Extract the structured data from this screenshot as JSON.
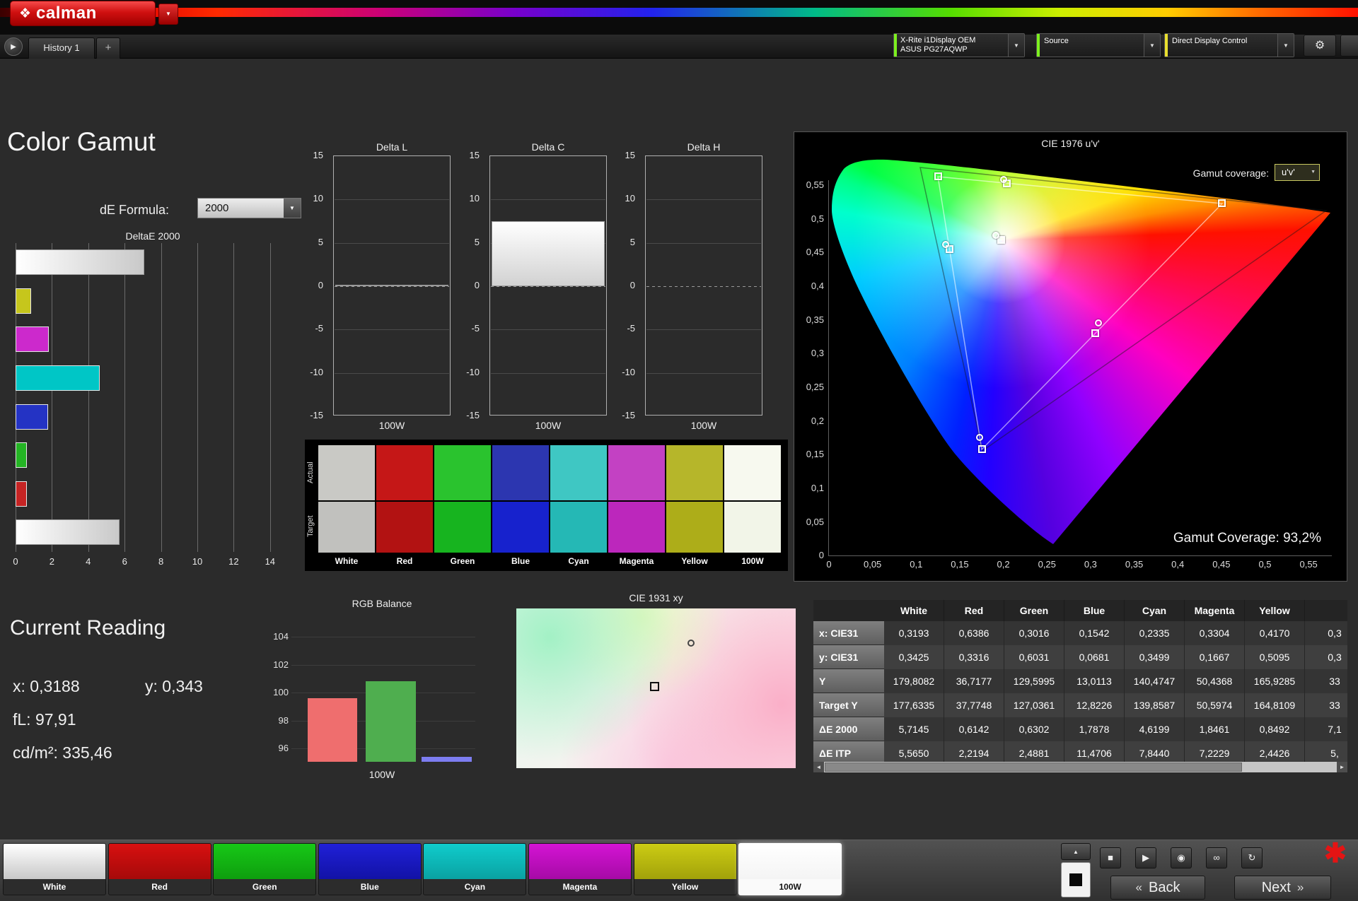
{
  "header": {
    "logo_text": "calman",
    "logo_icon": "❖",
    "logo_caret": "▼",
    "tab_scroll_icon": "▶",
    "history_tab": "History 1",
    "add_tab": "+",
    "meter_dropdown": {
      "line1": "X-Rite i1Display OEM",
      "line2": "ASUS PG27AQWP",
      "caret": "▼",
      "stripe": "#7df01e"
    },
    "source_dropdown": {
      "label": "Source",
      "caret": "▼",
      "stripe": "#7df01e"
    },
    "display_dropdown": {
      "label": "Direct Display Control",
      "caret": "▼",
      "stripe": "#e8df2e"
    },
    "settings_icon": "⚙"
  },
  "page": {
    "title": "Color Gamut",
    "de_formula_label": "dE Formula:",
    "de_formula_value": "2000",
    "de_formula_caret": "▼"
  },
  "chart_data": [
    {
      "type": "bar",
      "title": "DeltaE 2000",
      "orientation": "horizontal",
      "categories": [
        "100W",
        "Yellow",
        "Magenta",
        "Cyan",
        "Blue",
        "Green",
        "Red",
        "White"
      ],
      "values": [
        7.1,
        0.8492,
        1.8461,
        4.6199,
        1.7878,
        0.6302,
        0.6142,
        5.7145
      ],
      "colors": [
        "white-gradient",
        "#c6c61c",
        "#cc29cc",
        "#00c6c6",
        "#2433c4",
        "#24b424",
        "#c62424",
        "white-gradient"
      ],
      "x_ticks": [
        0,
        2,
        4,
        6,
        8,
        10,
        12,
        14
      ],
      "xlim": [
        0,
        15.1
      ]
    },
    {
      "type": "bar",
      "title": "Delta L",
      "xlabel": "100W",
      "values": [
        0.2
      ],
      "y_ticks": [
        15,
        10,
        5,
        0,
        -5,
        -10,
        -15
      ],
      "ylim": [
        -15,
        15
      ]
    },
    {
      "type": "bar",
      "title": "Delta C",
      "xlabel": "100W",
      "values": [
        7.5
      ],
      "y_ticks": [
        15,
        10,
        5,
        0,
        -5,
        -10,
        -15
      ],
      "ylim": [
        -15,
        15
      ]
    },
    {
      "type": "bar",
      "title": "Delta H",
      "xlabel": "100W",
      "values": [
        0
      ],
      "y_ticks": [
        15,
        10,
        5,
        0,
        -5,
        -10,
        -15
      ],
      "ylim": [
        -15,
        15
      ]
    },
    {
      "type": "bar",
      "title": "RGB Balance",
      "xlabel": "100W",
      "categories": [
        "Red",
        "Green",
        "Blue"
      ],
      "values": [
        99.6,
        100.8,
        95.4
      ],
      "colors": [
        "#ef6e6e",
        "#4fae4f",
        "#7d7df0"
      ],
      "y_ticks": [
        104,
        102,
        100,
        98,
        96
      ],
      "ylim": [
        95,
        105
      ]
    },
    {
      "type": "scatter",
      "title": "CIE 1976 u'v'",
      "coverage_label": "Gamut coverage:",
      "coverage_mode": "u'v'",
      "coverage_caret": "▼",
      "coverage_text": "Gamut Coverage:  93,2%",
      "x_ticks": [
        "0",
        "0,05",
        "0,1",
        "0,15",
        "0,2",
        "0,25",
        "0,3",
        "0,35",
        "0,4",
        "0,45",
        "0,5",
        "0,55"
      ],
      "y_ticks": [
        "0,55",
        "0,5",
        "0,45",
        "0,4",
        "0,35",
        "0,3",
        "0,25",
        "0,2",
        "0,15",
        "0,1",
        "0,05",
        "0"
      ],
      "targets": [
        {
          "name": "red",
          "u": 0.4507,
          "v": 0.5229
        },
        {
          "name": "green",
          "u": 0.125,
          "v": 0.5625
        },
        {
          "name": "blue",
          "u": 0.1754,
          "v": 0.1579
        },
        {
          "name": "cyan",
          "u": 0.1383,
          "v": 0.4554
        },
        {
          "name": "magenta",
          "u": 0.3051,
          "v": 0.3298
        },
        {
          "name": "yellow",
          "u": 0.2039,
          "v": 0.5529
        },
        {
          "name": "white",
          "u": 0.1978,
          "v": 0.4683
        }
      ],
      "measured": [
        {
          "name": "white",
          "u": 0.191,
          "v": 0.475
        },
        {
          "name": "cyan",
          "u": 0.134,
          "v": 0.462
        },
        {
          "name": "magenta",
          "u": 0.309,
          "v": 0.345
        },
        {
          "name": "yellow",
          "u": 0.2,
          "v": 0.558
        },
        {
          "name": "blue",
          "u": 0.173,
          "v": 0.175
        }
      ]
    },
    {
      "type": "scatter",
      "title": "CIE 1931 xy",
      "markers": [
        {
          "shape": "circle",
          "fx": 0.625,
          "fy": 0.215
        },
        {
          "shape": "square",
          "fx": 0.495,
          "fy": 0.49
        }
      ]
    },
    {
      "type": "table",
      "headers": [
        "White",
        "Red",
        "Green",
        "Blue",
        "Cyan",
        "Magenta",
        "Yellow"
      ],
      "rows": [
        {
          "label": "x: CIE31",
          "values": [
            "0,3193",
            "0,6386",
            "0,3016",
            "0,1542",
            "0,2335",
            "0,3304",
            "0,4170",
            "0,3"
          ]
        },
        {
          "label": "y: CIE31",
          "values": [
            "0,3425",
            "0,3316",
            "0,6031",
            "0,0681",
            "0,3499",
            "0,1667",
            "0,5095",
            "0,3"
          ]
        },
        {
          "label": "Y",
          "values": [
            "179,8082",
            "36,7177",
            "129,5995",
            "13,0113",
            "140,4747",
            "50,4368",
            "165,9285",
            "33"
          ]
        },
        {
          "label": "Target Y",
          "values": [
            "177,6335",
            "37,7748",
            "127,0361",
            "12,8226",
            "139,8587",
            "50,5974",
            "164,8109",
            "33"
          ]
        },
        {
          "label": "ΔE 2000",
          "values": [
            "5,7145",
            "0,6142",
            "0,6302",
            "1,7878",
            "4,6199",
            "1,8461",
            "0,8492",
            "7,1"
          ]
        },
        {
          "label": "ΔE ITP",
          "values": [
            "5,5650",
            "2,2194",
            "2,4881",
            "11,4706",
            "7,8440",
            "7,2229",
            "2,4426",
            "5,"
          ]
        }
      ]
    }
  ],
  "swatches": {
    "row_labels": [
      "Actual",
      "Target"
    ],
    "columns": [
      {
        "name": "White",
        "actual": "#c9c9c5",
        "target": "#c1c1be"
      },
      {
        "name": "Red",
        "actual": "#c51717",
        "target": "#b21212"
      },
      {
        "name": "Green",
        "actual": "#2ac32e",
        "target": "#17b41f"
      },
      {
        "name": "Blue",
        "actual": "#2c36b0",
        "target": "#1722cd"
      },
      {
        "name": "Cyan",
        "actual": "#3fc7c3",
        "target": "#25b8b5"
      },
      {
        "name": "Magenta",
        "actual": "#c341c3",
        "target": "#bc27bc"
      },
      {
        "name": "Yellow",
        "actual": "#b6b62a",
        "target": "#adad19"
      },
      {
        "name": "100W",
        "actual": "#f7f9ef",
        "target": "#f2f5e8"
      }
    ]
  },
  "current_reading": {
    "title": "Current Reading",
    "x": "x: 0,3188",
    "y": "y: 0,343",
    "fl": "fL: 97,91",
    "cdm2": "cd/m²: 335,46"
  },
  "scrollbar": {
    "left_arrow": "◄",
    "right_arrow": "►"
  },
  "bottom": {
    "patches": [
      {
        "name": "White",
        "color_top": "#ffffff",
        "color_bottom": "#c8c8c8",
        "selected": false
      },
      {
        "name": "Red",
        "color_top": "#d81010",
        "color_bottom": "#a60a0a",
        "selected": false
      },
      {
        "name": "Green",
        "color_top": "#17c817",
        "color_bottom": "#0e9e0e",
        "selected": false
      },
      {
        "name": "Blue",
        "color_top": "#2020d8",
        "color_bottom": "#1212a6",
        "selected": false
      },
      {
        "name": "Cyan",
        "color_top": "#10cccc",
        "color_bottom": "#0aa2a2",
        "selected": false
      },
      {
        "name": "Magenta",
        "color_top": "#d414d4",
        "color_bottom": "#a60aa6",
        "selected": false
      },
      {
        "name": "Yellow",
        "color_top": "#cccc14",
        "color_bottom": "#a2a20a",
        "selected": false
      },
      {
        "name": "100W",
        "color_top": "#ffffff",
        "color_bottom": "#f4f4f4",
        "selected": true
      }
    ],
    "pattern_up_icon": "▲",
    "transport": [
      {
        "name": "stop-icon",
        "glyph": "■"
      },
      {
        "name": "play-icon",
        "glyph": "▶"
      },
      {
        "name": "record-icon",
        "glyph": "◉"
      },
      {
        "name": "continuous-icon",
        "glyph": "∞"
      },
      {
        "name": "refresh-icon",
        "glyph": "↻"
      }
    ],
    "alert_icon": "✱",
    "back_chevron": "«",
    "back_label": "Back",
    "next_label": "Next",
    "next_chevron": "»"
  }
}
